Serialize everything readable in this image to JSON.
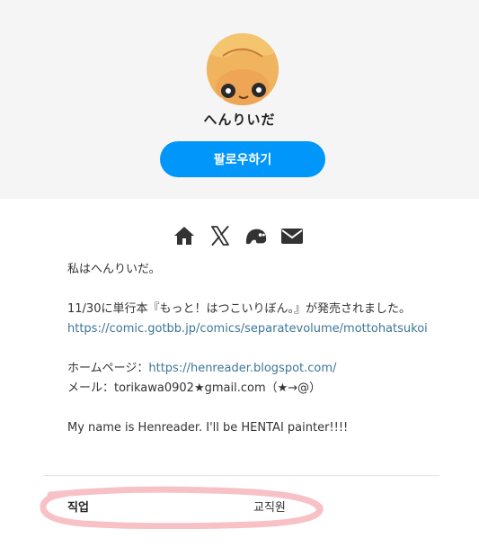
{
  "profile": {
    "name": "へんりいだ",
    "follow_label": "팔로우하기"
  },
  "social": {
    "icons": [
      "home-icon",
      "x-icon",
      "pawoo-icon",
      "mail-icon"
    ]
  },
  "bio": {
    "line1": "私はへんりいだ。",
    "line2": "11/30に単行本『もっと！はつこいりぼん。』が発売されました。",
    "link1": "https://comic.gotbb.jp/comics/separatevolume/mottohatsukoi",
    "homepage_prefix": "ホームページ：",
    "homepage_link": "https://henreader.blogspot.com/",
    "mail_line": "メール：torikawa0902★gmail.com（★→@）",
    "english_line": "My name is Henreader. I'll be HENTAI painter!!!!"
  },
  "details": {
    "job_label": "직업",
    "job_value": "교직원"
  },
  "colors": {
    "accent": "#0096fa",
    "link": "#3d7699",
    "header_bg": "#f5f5f5"
  }
}
